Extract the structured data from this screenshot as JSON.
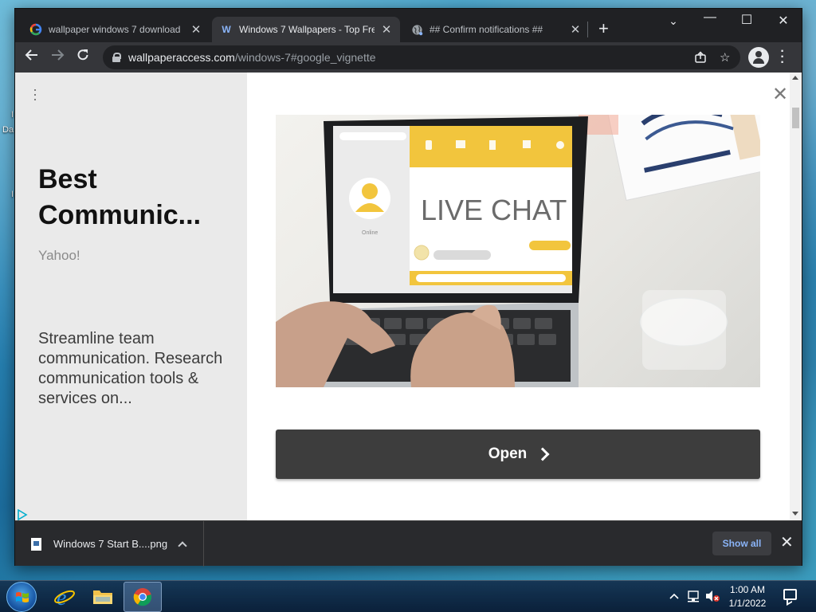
{
  "desktop": {
    "fragments": [
      "I",
      "Da",
      "I"
    ]
  },
  "tabs": [
    {
      "title": "wallpaper windows 7 download",
      "favicon": "google-icon",
      "active": false
    },
    {
      "title": "Windows 7 Wallpapers - Top Fre",
      "favicon": "wallpaperaccess-icon",
      "favicon_text": "W",
      "active": true
    },
    {
      "title": "## Confirm notifications ##",
      "favicon": "globe-icon",
      "active": false
    }
  ],
  "window_controls": {
    "minimize": "—",
    "maximize": "☐",
    "close": "✕"
  },
  "toolbar": {
    "url_host": "wallpaperaccess.com",
    "url_path": "/windows-7#google_vignette"
  },
  "ad": {
    "title": "Best Communic...",
    "source": "Yahoo!",
    "description": "Streamline team communication. Research communication tools & services on...",
    "image_text": "LIVE CHAT",
    "image_status": "Online",
    "open_label": "Open"
  },
  "download_shelf": {
    "file_name": "Windows 7 Start B....png",
    "show_all_label": "Show all"
  },
  "taskbar": {
    "time": "1:00 AM",
    "date": "1/1/2022"
  },
  "colors": {
    "chrome_dark": "#202124",
    "toolbar": "#35363a",
    "link_blue": "#8ab4f8",
    "chat_yellow": "#f2c53d"
  }
}
